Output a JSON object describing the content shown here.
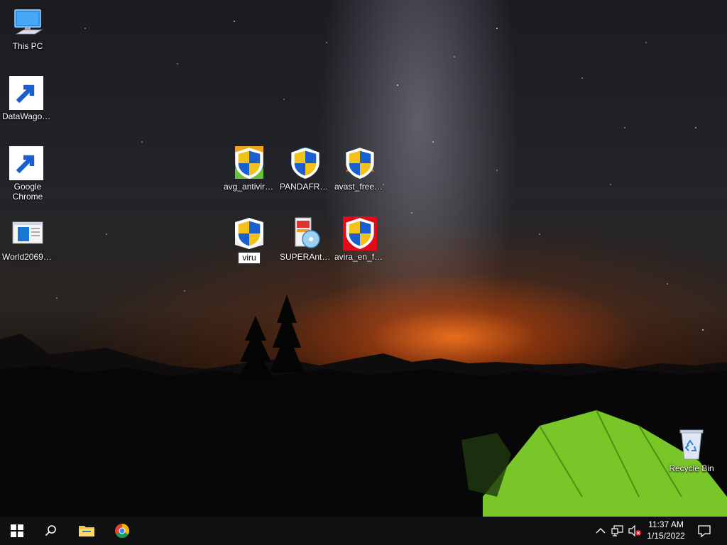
{
  "desktop": {
    "icons": [
      {
        "id": "this-pc",
        "label": "This PC",
        "icon": "computer-icon"
      },
      {
        "id": "datawagon",
        "label": "DataWagon...",
        "icon": "datawagon-icon"
      },
      {
        "id": "google-chrome",
        "label": "Google Chrome",
        "icon": "chrome-icon"
      },
      {
        "id": "world2069",
        "label": "World2069D...",
        "icon": "window-app-icon"
      },
      {
        "id": "avg",
        "label": "avg_antiviru...",
        "icon": "avg-installer-icon"
      },
      {
        "id": "panda",
        "label": "PANDAFRE...",
        "icon": "panda-installer-icon"
      },
      {
        "id": "avast",
        "label": "avast_free_a...",
        "icon": "avast-installer-icon"
      },
      {
        "id": "malwarebytes",
        "label": "viru",
        "icon": "malwarebytes-installer-icon"
      },
      {
        "id": "superantispyware",
        "label": "SUPERAnti...",
        "icon": "superantispyware-installer-icon"
      },
      {
        "id": "avira",
        "label": "avira_en_fro...",
        "icon": "avira-installer-icon"
      },
      {
        "id": "recycle-bin",
        "label": "Recycle Bin",
        "icon": "recycle-bin-icon"
      }
    ]
  },
  "taskbar": {
    "start_icon": "windows-start-icon",
    "search_icon": "search-icon",
    "pinned": [
      {
        "name": "file-explorer",
        "icon": "folder-icon"
      },
      {
        "name": "chrome",
        "icon": "chrome-icon"
      }
    ],
    "tray": {
      "time": "11:37 AM",
      "date": "1/15/2022",
      "icons": [
        "chevron-up-icon",
        "network-icon",
        "volume-muted-icon",
        "notification-icon"
      ]
    }
  }
}
